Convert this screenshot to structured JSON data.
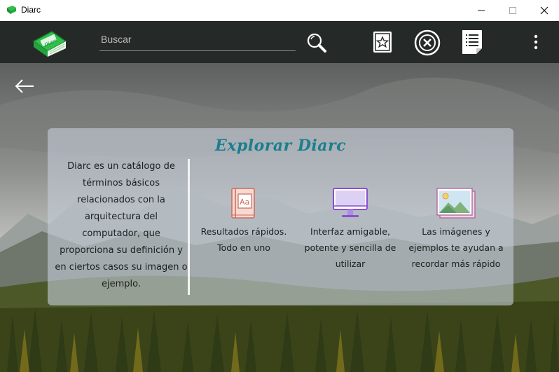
{
  "window": {
    "title": "Diarc",
    "controls": [
      "minimize",
      "maximize",
      "close"
    ]
  },
  "toolbar": {
    "logo_icon": "green-book-logo",
    "logo_text": "Diarc",
    "search_placeholder": "Buscar",
    "search_value": "",
    "icons": [
      "search-icon",
      "favorites-star-icon",
      "close-circle-icon",
      "list-document-icon",
      "more-vertical-icon"
    ]
  },
  "colors": {
    "toolbar_bg": "#252a29",
    "accent_teal": "#1a7f8e",
    "logo_green": "#2ec04a"
  },
  "panel": {
    "title": "Explorar Diarc",
    "description": "Diarc es un catálogo de términos básicos relacionados con la arquitectura del computador, que proporciona su definición y en ciertos casos su imagen o ejemplo.",
    "features": [
      {
        "icon": "dictionary-book-icon",
        "text": "Resultados rápidos. Todo en uno"
      },
      {
        "icon": "monitor-icon",
        "text": "Interfaz amigable, potente y sencilla de utilizar"
      },
      {
        "icon": "landscape-image-icon",
        "text": "Las imágenes y ejemplos te ayudan a recordar más rápido"
      }
    ]
  }
}
